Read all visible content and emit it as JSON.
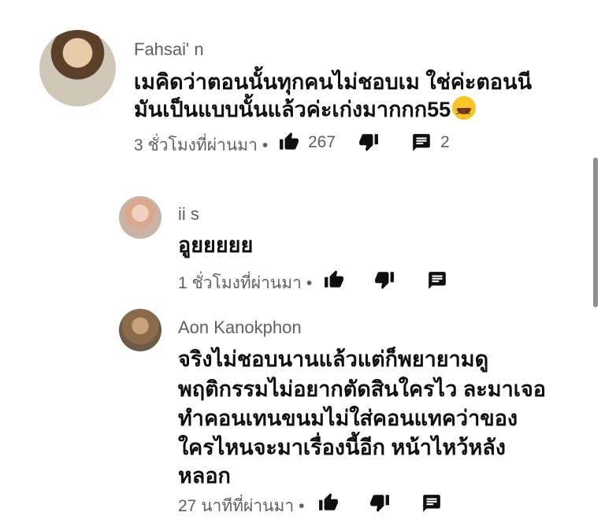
{
  "comments": [
    {
      "author": "Fahsai' n",
      "lines": [
        "เมคิดว่าตอนนั้นทุกคนไม่ชอบเม ใช่ค่ะตอนนี",
        "มันเป็นแบบนั้นแล้วค่ะเก่งมากกก55"
      ],
      "emoji": "laughing-face",
      "time": "3 ชั่วโมงที่ผ่านมา",
      "likes": "267",
      "replies": "2"
    },
    {
      "author": "ii s",
      "lines": [
        "อูยยยยย"
      ],
      "time": "1 ชั่วโมงที่ผ่านมา"
    },
    {
      "author": "Aon Kanokphon",
      "lines": [
        "จริงไม่ชอบนานแล้วแต่ก็พยายามดู",
        "พฤติกรรมไม่อยากตัดสินใครไว ละมาเจอ",
        "ทำคอนเทนขนมไม่ใส่คอนแทคว่าของ",
        "ใครไหนจะมาเรื่องนี้อีก หน้าไหว้หลัง",
        "หลอก"
      ],
      "time": "27 นาทีที่ผ่านมา"
    }
  ],
  "separator": "•",
  "icons": {
    "like": "thumb-up-icon",
    "dislike": "thumb-down-icon",
    "reply": "comment-icon"
  },
  "colors": {
    "text": "#0f0f0f",
    "meta": "#606060",
    "background": "#ffffff"
  }
}
